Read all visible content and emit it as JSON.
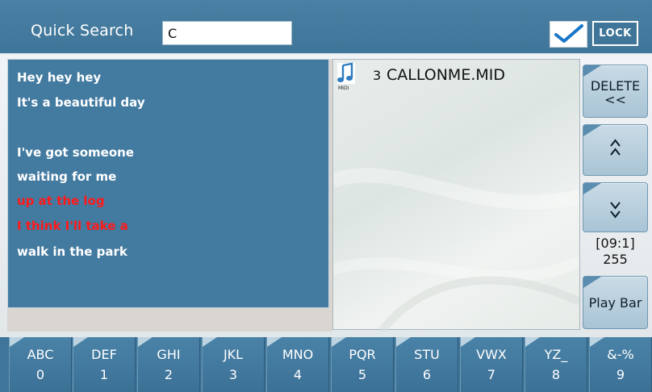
{
  "header": {
    "search_label": "Quick Search",
    "search_value": "C",
    "lock_label": "LOCK",
    "lock_checked": true,
    "check_icon": "check-icon"
  },
  "lyrics": {
    "lines": [
      {
        "text": "Hey hey hey",
        "highlighted": false
      },
      {
        "text": "It's a beautiful day",
        "highlighted": false
      },
      {
        "text": "",
        "highlighted": false
      },
      {
        "text": "I've got someone",
        "highlighted": false
      },
      {
        "text": "waiting for me",
        "highlighted": false
      },
      {
        "text": "up at the log",
        "highlighted": true
      },
      {
        "text": "I think I'll take a",
        "highlighted": true
      },
      {
        "text": "walk in the park",
        "highlighted": false
      }
    ]
  },
  "filelist": {
    "items": [
      {
        "index": "3",
        "name": "CALLONME.MID",
        "icon": "midi-icon",
        "icon_caption": "MIDI"
      }
    ]
  },
  "side": {
    "delete_label": "DELETE",
    "delete_arrow": "<<",
    "up_icon": "double-chevron-up-icon",
    "down_icon": "double-chevron-down-icon",
    "counter_position": "[09:1]",
    "counter_total": "255",
    "play_bar_label": "Play Bar"
  },
  "keypad": {
    "keys": [
      {
        "letters": "ABC",
        "digit": "0"
      },
      {
        "letters": "DEF",
        "digit": "1"
      },
      {
        "letters": "GHI",
        "digit": "2"
      },
      {
        "letters": "JKL",
        "digit": "3"
      },
      {
        "letters": "MNO",
        "digit": "4"
      },
      {
        "letters": "PQR",
        "digit": "5"
      },
      {
        "letters": "STU",
        "digit": "6"
      },
      {
        "letters": "VWX",
        "digit": "7"
      },
      {
        "letters": "YZ_",
        "digit": "8"
      },
      {
        "letters": "&-%",
        "digit": "9"
      }
    ]
  },
  "colors": {
    "header_blue": "#437aa0",
    "lyric_text": "#ffffff",
    "lyric_highlight": "#ff1a1a",
    "check_blue": "#1976c8"
  }
}
